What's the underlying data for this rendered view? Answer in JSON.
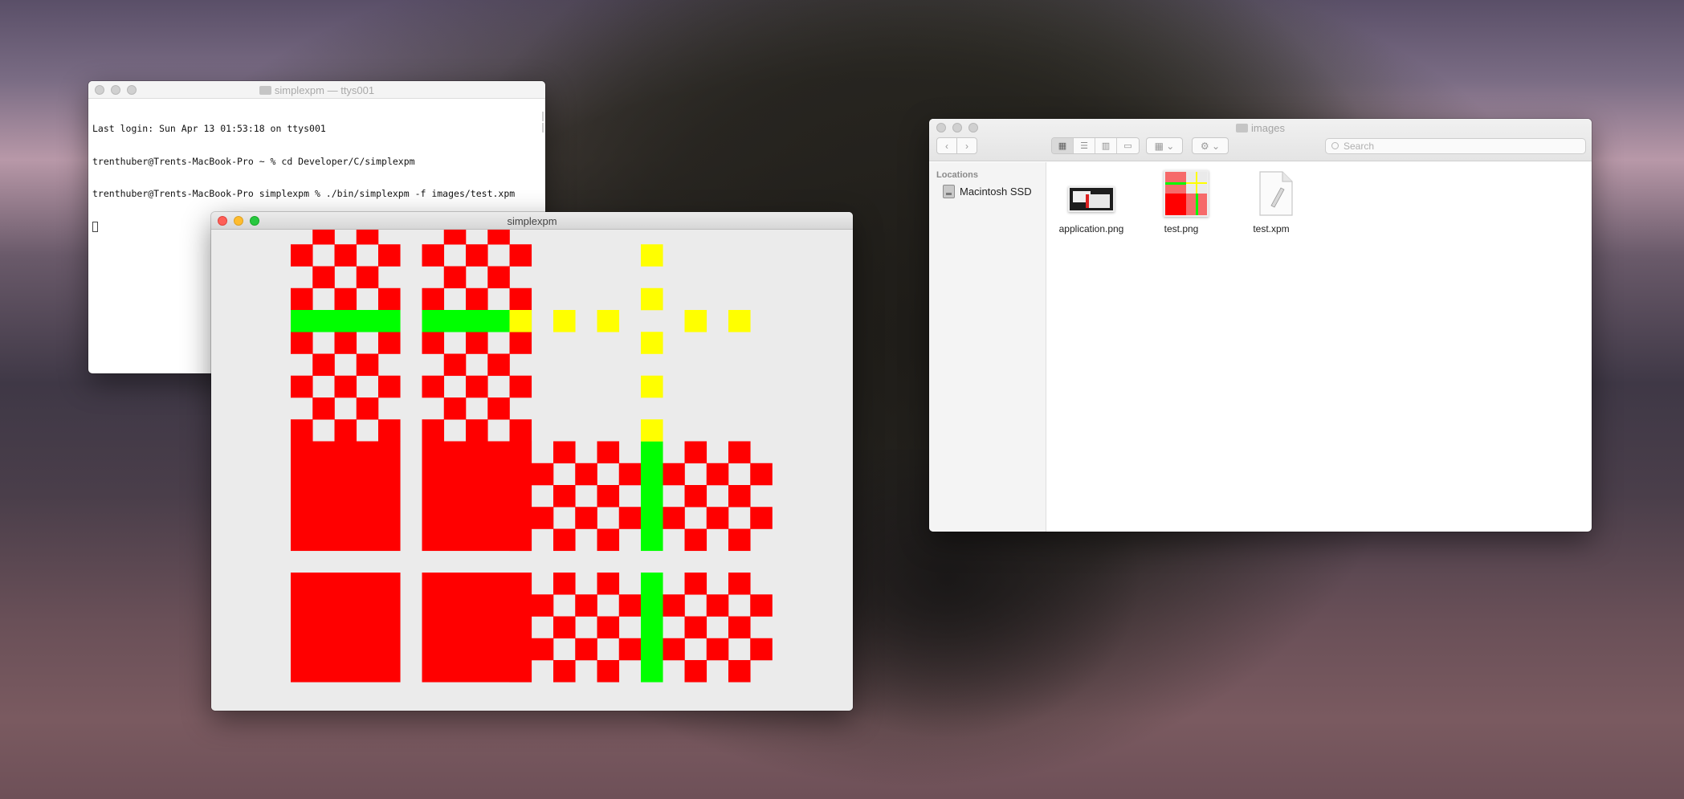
{
  "terminal": {
    "title": "simplexpm — ttys001",
    "lines": [
      "Last login: Sun Apr 13 01:53:18 on ttys001",
      "trenthuber@Trents-MacBook-Pro ~ % cd Developer/C/simplexpm",
      "trenthuber@Trents-MacBook-Pro simplexpm % ./bin/simplexpm -f images/test.xpm"
    ]
  },
  "finder": {
    "title": "images",
    "search_placeholder": "Search",
    "sidebar": {
      "heading": "Locations",
      "items": [
        {
          "label": "Macintosh SSD",
          "icon": "disk-icon"
        }
      ]
    },
    "files": [
      {
        "name": "application.png",
        "icon": "image-thumbnail-icon"
      },
      {
        "name": "test.png",
        "icon": "image-thumbnail-icon"
      },
      {
        "name": "test.xpm",
        "icon": "document-icon"
      }
    ]
  },
  "simplexpm": {
    "title": "simplexpm",
    "colors": {
      "background": "#ebebeb",
      "red": "#ff0000",
      "green": "#00ff00",
      "yellow": "#ffff00"
    }
  },
  "traffic_lights": {
    "close": "#fe5f57",
    "minimize": "#febc2e",
    "zoom": "#28c840",
    "inactive": "#d0d0d0"
  }
}
